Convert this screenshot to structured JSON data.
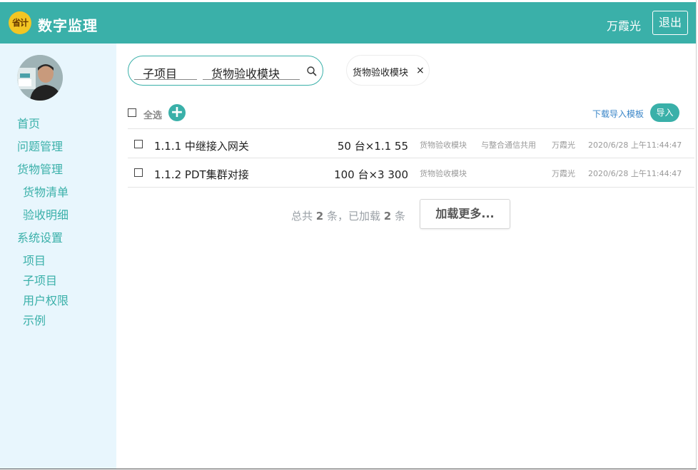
{
  "header": {
    "logo_text": "省计",
    "app_title": "数字监理",
    "user_name": "万霞光",
    "logout_label": "退出"
  },
  "sidebar": {
    "items": [
      {
        "label": "首页",
        "level": 1
      },
      {
        "label": "问题管理",
        "level": 1
      },
      {
        "label": "货物管理",
        "level": 1
      },
      {
        "label": "货物清单",
        "level": 2
      },
      {
        "label": "验收明细",
        "level": 2
      },
      {
        "label": "系统设置",
        "level": 1
      },
      {
        "label": "项目",
        "level": 2
      },
      {
        "label": "子项目",
        "level": 2
      },
      {
        "label": "用户权限",
        "level": 2
      },
      {
        "label": "示例",
        "level": 2
      }
    ]
  },
  "search": {
    "field1_value": "子项目",
    "field2_value": "货物验收模块"
  },
  "filter_chip": {
    "label": "货物验收模块",
    "close": "×"
  },
  "toolbar": {
    "select_all_label": "全选",
    "add_label": "+",
    "download_template_label": "下载导入模板",
    "import_label": "导入"
  },
  "rows": [
    {
      "name": "1.1.1 中继接入网关",
      "qty": "50 台×1.1 55",
      "module": "货物验收模块",
      "note": "与整合通信共用",
      "person": "万霞光",
      "time": "2020/6/28 上午11:44:47"
    },
    {
      "name": "1.1.2 PDT集群对接",
      "qty": "100 台×3 300",
      "module": "货物验收模块",
      "note": "",
      "person": "万霞光",
      "time": "2020/6/28 上午11:44:47"
    }
  ],
  "footer": {
    "summary_prefix": "总共 ",
    "total": "2",
    "summary_mid": " 条，已加载 ",
    "loaded": "2",
    "summary_suffix": " 条",
    "load_more_label": "加载更多..."
  },
  "colors": {
    "accent": "#3ab0a9",
    "sidebar_bg": "#e8f6fd",
    "link": "#3a86c8"
  }
}
